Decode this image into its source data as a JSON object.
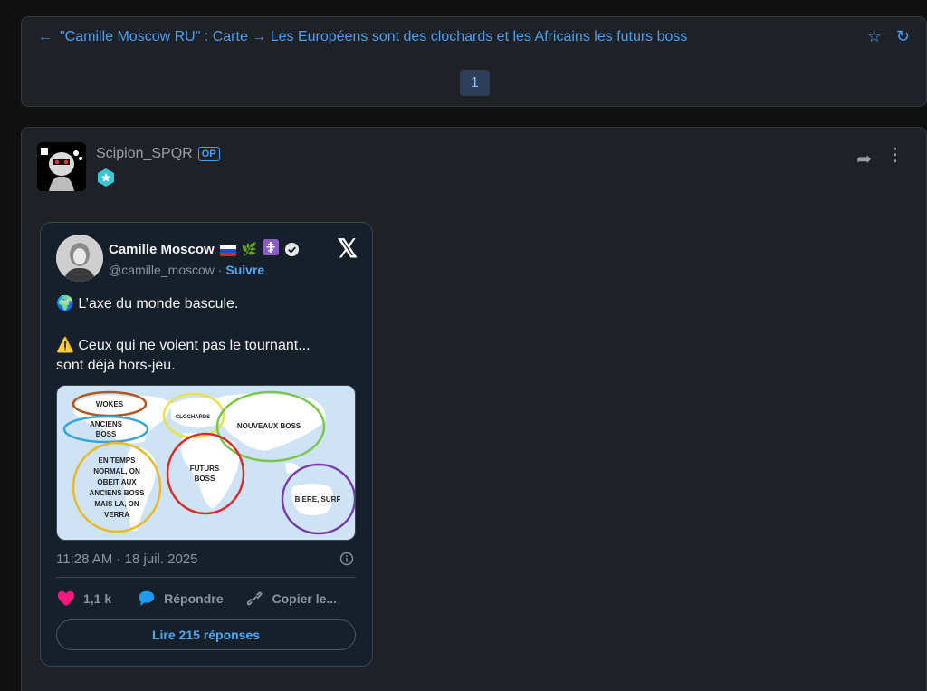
{
  "topic": {
    "title": "\"Camille Moscow RU\" : Carte → Les Européens sont des clochards et les Africains les futurs boss",
    "page": "1"
  },
  "post": {
    "username": "Scipion_SPQR",
    "op_label": "OP"
  },
  "tweet": {
    "name": "Camille Moscow",
    "handle": "@camille_moscow",
    "separator": " · ",
    "follow": "Suivre",
    "line1": "🌍 L’axe du monde bascule.",
    "line2": "⚠️ Ceux qui ne voient pas le tournant...",
    "line3": "sont déjà hors-jeu.",
    "time": "11:28 AM · 18 juil. 2025",
    "likes": "1,1 k",
    "reply": "Répondre",
    "copy": "Copier le...",
    "read_replies": "Lire 215 réponses",
    "map_labels": {
      "wokes": "WOKES",
      "anciens_boss_1": "ANCIENS",
      "anciens_boss_2": "BOSS",
      "clochards": "CLOCHARDS",
      "nouveaux_boss": "NOUVEAUX BOSS",
      "futurs_1": "FUTURS",
      "futurs_2": "BOSS",
      "en_temps_1": "EN TEMPS",
      "en_temps_2": "NORMAL, ON",
      "en_temps_3": "OBEIT AUX",
      "en_temps_4": "ANCIENS BOSS",
      "en_temps_5": "MAIS LA, ON",
      "en_temps_6": "VERRA",
      "biere": "BIERE, SURF"
    }
  },
  "colors": {
    "accent": "#4b9ff2",
    "panel": "#1e2126",
    "tweet_bg": "#16202b",
    "like": "#f91880"
  }
}
